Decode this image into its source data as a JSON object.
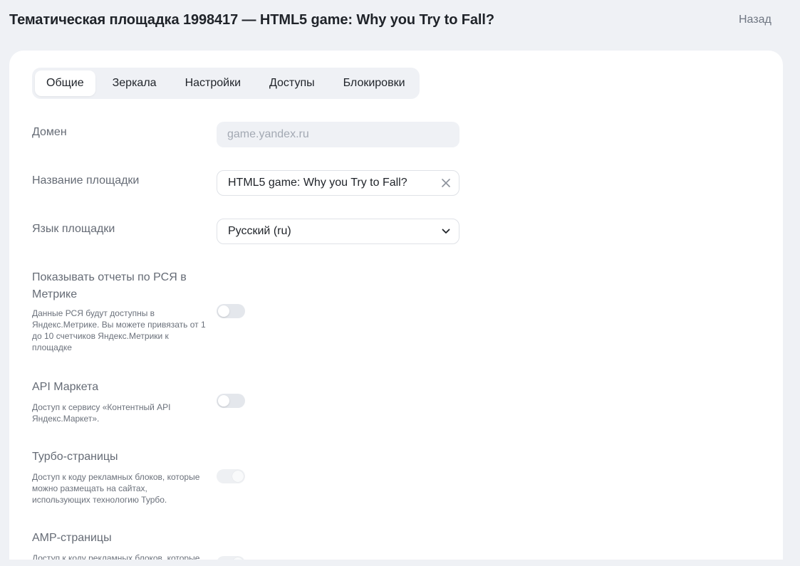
{
  "header": {
    "title": "Тематическая площадка 1998417 — HTML5 game: Why you Try to Fall?",
    "back_label": "Назад"
  },
  "tabs": [
    {
      "label": "Общие",
      "active": true
    },
    {
      "label": "Зеркала",
      "active": false
    },
    {
      "label": "Настройки",
      "active": false
    },
    {
      "label": "Доступы",
      "active": false
    },
    {
      "label": "Блокировки",
      "active": false
    }
  ],
  "form": {
    "domain": {
      "label": "Домен",
      "value": "game.yandex.ru"
    },
    "site_name": {
      "label": "Название площадки",
      "value": "HTML5 game: Why you Try to Fall?"
    },
    "language": {
      "label": "Язык площадки",
      "value": "Русский (ru)"
    },
    "rsya_metrika": {
      "label": "Показывать отчеты по РСЯ в Метрике",
      "description": "Данные РСЯ будут доступны в Яндекс.Метрике. Вы можете привязать от 1 до 10 счетчиков Яндекс.Метрики к площадке",
      "enabled": false
    },
    "market_api": {
      "label": "API Маркета",
      "description": "Доступ к сервису «Контентный API Яндекс.Маркет».",
      "enabled": false
    },
    "turbo": {
      "label": "Турбо-страницы",
      "description": "Доступ к коду рекламных блоков, которые можно размещать на сайтах, использующих технологию Турбо.",
      "enabled": true,
      "disabled": true
    },
    "amp": {
      "label": "AMP-страницы",
      "description": "Доступ к коду рекламных блоков, которые"
    }
  },
  "icons": {
    "clear": "close-icon",
    "dropdown": "chevron-down-icon"
  },
  "colors": {
    "page_bg": "#eff1f5",
    "card_bg": "#ffffff",
    "toggle_off": "#e4e7ec"
  }
}
